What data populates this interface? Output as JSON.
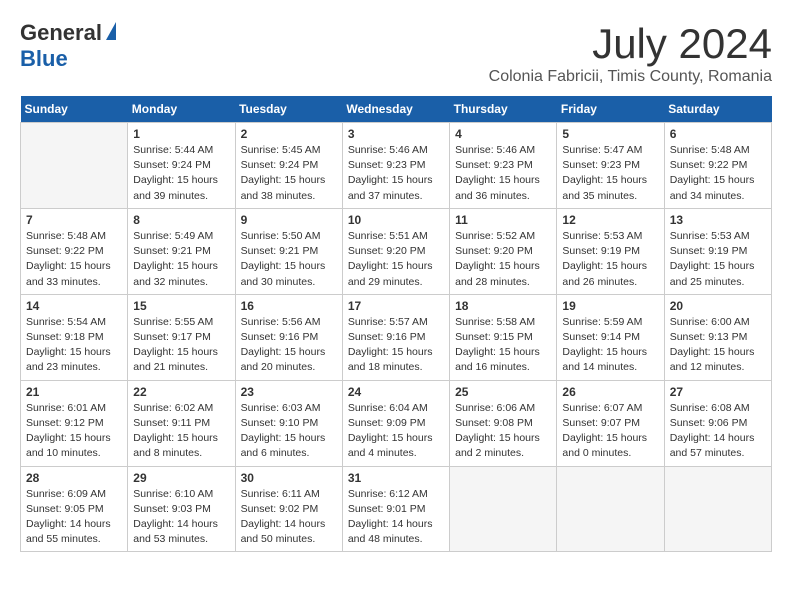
{
  "header": {
    "logo": {
      "general": "General",
      "blue": "Blue"
    },
    "title": "July 2024",
    "subtitle": "Colonia Fabricii, Timis County, Romania"
  },
  "calendar": {
    "headers": [
      "Sunday",
      "Monday",
      "Tuesday",
      "Wednesday",
      "Thursday",
      "Friday",
      "Saturday"
    ],
    "weeks": [
      [
        {
          "day": "",
          "info": ""
        },
        {
          "day": "1",
          "info": "Sunrise: 5:44 AM\nSunset: 9:24 PM\nDaylight: 15 hours\nand 39 minutes."
        },
        {
          "day": "2",
          "info": "Sunrise: 5:45 AM\nSunset: 9:24 PM\nDaylight: 15 hours\nand 38 minutes."
        },
        {
          "day": "3",
          "info": "Sunrise: 5:46 AM\nSunset: 9:23 PM\nDaylight: 15 hours\nand 37 minutes."
        },
        {
          "day": "4",
          "info": "Sunrise: 5:46 AM\nSunset: 9:23 PM\nDaylight: 15 hours\nand 36 minutes."
        },
        {
          "day": "5",
          "info": "Sunrise: 5:47 AM\nSunset: 9:23 PM\nDaylight: 15 hours\nand 35 minutes."
        },
        {
          "day": "6",
          "info": "Sunrise: 5:48 AM\nSunset: 9:22 PM\nDaylight: 15 hours\nand 34 minutes."
        }
      ],
      [
        {
          "day": "7",
          "info": "Sunrise: 5:48 AM\nSunset: 9:22 PM\nDaylight: 15 hours\nand 33 minutes."
        },
        {
          "day": "8",
          "info": "Sunrise: 5:49 AM\nSunset: 9:21 PM\nDaylight: 15 hours\nand 32 minutes."
        },
        {
          "day": "9",
          "info": "Sunrise: 5:50 AM\nSunset: 9:21 PM\nDaylight: 15 hours\nand 30 minutes."
        },
        {
          "day": "10",
          "info": "Sunrise: 5:51 AM\nSunset: 9:20 PM\nDaylight: 15 hours\nand 29 minutes."
        },
        {
          "day": "11",
          "info": "Sunrise: 5:52 AM\nSunset: 9:20 PM\nDaylight: 15 hours\nand 28 minutes."
        },
        {
          "day": "12",
          "info": "Sunrise: 5:53 AM\nSunset: 9:19 PM\nDaylight: 15 hours\nand 26 minutes."
        },
        {
          "day": "13",
          "info": "Sunrise: 5:53 AM\nSunset: 9:19 PM\nDaylight: 15 hours\nand 25 minutes."
        }
      ],
      [
        {
          "day": "14",
          "info": "Sunrise: 5:54 AM\nSunset: 9:18 PM\nDaylight: 15 hours\nand 23 minutes."
        },
        {
          "day": "15",
          "info": "Sunrise: 5:55 AM\nSunset: 9:17 PM\nDaylight: 15 hours\nand 21 minutes."
        },
        {
          "day": "16",
          "info": "Sunrise: 5:56 AM\nSunset: 9:16 PM\nDaylight: 15 hours\nand 20 minutes."
        },
        {
          "day": "17",
          "info": "Sunrise: 5:57 AM\nSunset: 9:16 PM\nDaylight: 15 hours\nand 18 minutes."
        },
        {
          "day": "18",
          "info": "Sunrise: 5:58 AM\nSunset: 9:15 PM\nDaylight: 15 hours\nand 16 minutes."
        },
        {
          "day": "19",
          "info": "Sunrise: 5:59 AM\nSunset: 9:14 PM\nDaylight: 15 hours\nand 14 minutes."
        },
        {
          "day": "20",
          "info": "Sunrise: 6:00 AM\nSunset: 9:13 PM\nDaylight: 15 hours\nand 12 minutes."
        }
      ],
      [
        {
          "day": "21",
          "info": "Sunrise: 6:01 AM\nSunset: 9:12 PM\nDaylight: 15 hours\nand 10 minutes."
        },
        {
          "day": "22",
          "info": "Sunrise: 6:02 AM\nSunset: 9:11 PM\nDaylight: 15 hours\nand 8 minutes."
        },
        {
          "day": "23",
          "info": "Sunrise: 6:03 AM\nSunset: 9:10 PM\nDaylight: 15 hours\nand 6 minutes."
        },
        {
          "day": "24",
          "info": "Sunrise: 6:04 AM\nSunset: 9:09 PM\nDaylight: 15 hours\nand 4 minutes."
        },
        {
          "day": "25",
          "info": "Sunrise: 6:06 AM\nSunset: 9:08 PM\nDaylight: 15 hours\nand 2 minutes."
        },
        {
          "day": "26",
          "info": "Sunrise: 6:07 AM\nSunset: 9:07 PM\nDaylight: 15 hours\nand 0 minutes."
        },
        {
          "day": "27",
          "info": "Sunrise: 6:08 AM\nSunset: 9:06 PM\nDaylight: 14 hours\nand 57 minutes."
        }
      ],
      [
        {
          "day": "28",
          "info": "Sunrise: 6:09 AM\nSunset: 9:05 PM\nDaylight: 14 hours\nand 55 minutes."
        },
        {
          "day": "29",
          "info": "Sunrise: 6:10 AM\nSunset: 9:03 PM\nDaylight: 14 hours\nand 53 minutes."
        },
        {
          "day": "30",
          "info": "Sunrise: 6:11 AM\nSunset: 9:02 PM\nDaylight: 14 hours\nand 50 minutes."
        },
        {
          "day": "31",
          "info": "Sunrise: 6:12 AM\nSunset: 9:01 PM\nDaylight: 14 hours\nand 48 minutes."
        },
        {
          "day": "",
          "info": ""
        },
        {
          "day": "",
          "info": ""
        },
        {
          "day": "",
          "info": ""
        }
      ]
    ]
  }
}
